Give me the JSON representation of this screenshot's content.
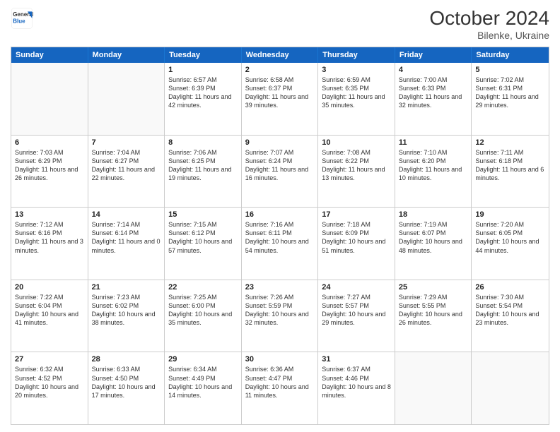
{
  "header": {
    "logo_line1": "General",
    "logo_line2": "Blue",
    "month": "October 2024",
    "location": "Bilenke, Ukraine"
  },
  "days_of_week": [
    "Sunday",
    "Monday",
    "Tuesday",
    "Wednesday",
    "Thursday",
    "Friday",
    "Saturday"
  ],
  "weeks": [
    [
      {
        "day": "",
        "info": "",
        "empty": true
      },
      {
        "day": "",
        "info": "",
        "empty": true
      },
      {
        "day": "1",
        "info": "Sunrise: 6:57 AM\nSunset: 6:39 PM\nDaylight: 11 hours and 42 minutes.",
        "empty": false
      },
      {
        "day": "2",
        "info": "Sunrise: 6:58 AM\nSunset: 6:37 PM\nDaylight: 11 hours and 39 minutes.",
        "empty": false
      },
      {
        "day": "3",
        "info": "Sunrise: 6:59 AM\nSunset: 6:35 PM\nDaylight: 11 hours and 35 minutes.",
        "empty": false
      },
      {
        "day": "4",
        "info": "Sunrise: 7:00 AM\nSunset: 6:33 PM\nDaylight: 11 hours and 32 minutes.",
        "empty": false
      },
      {
        "day": "5",
        "info": "Sunrise: 7:02 AM\nSunset: 6:31 PM\nDaylight: 11 hours and 29 minutes.",
        "empty": false
      }
    ],
    [
      {
        "day": "6",
        "info": "Sunrise: 7:03 AM\nSunset: 6:29 PM\nDaylight: 11 hours and 26 minutes.",
        "empty": false
      },
      {
        "day": "7",
        "info": "Sunrise: 7:04 AM\nSunset: 6:27 PM\nDaylight: 11 hours and 22 minutes.",
        "empty": false
      },
      {
        "day": "8",
        "info": "Sunrise: 7:06 AM\nSunset: 6:25 PM\nDaylight: 11 hours and 19 minutes.",
        "empty": false
      },
      {
        "day": "9",
        "info": "Sunrise: 7:07 AM\nSunset: 6:24 PM\nDaylight: 11 hours and 16 minutes.",
        "empty": false
      },
      {
        "day": "10",
        "info": "Sunrise: 7:08 AM\nSunset: 6:22 PM\nDaylight: 11 hours and 13 minutes.",
        "empty": false
      },
      {
        "day": "11",
        "info": "Sunrise: 7:10 AM\nSunset: 6:20 PM\nDaylight: 11 hours and 10 minutes.",
        "empty": false
      },
      {
        "day": "12",
        "info": "Sunrise: 7:11 AM\nSunset: 6:18 PM\nDaylight: 11 hours and 6 minutes.",
        "empty": false
      }
    ],
    [
      {
        "day": "13",
        "info": "Sunrise: 7:12 AM\nSunset: 6:16 PM\nDaylight: 11 hours and 3 minutes.",
        "empty": false
      },
      {
        "day": "14",
        "info": "Sunrise: 7:14 AM\nSunset: 6:14 PM\nDaylight: 11 hours and 0 minutes.",
        "empty": false
      },
      {
        "day": "15",
        "info": "Sunrise: 7:15 AM\nSunset: 6:12 PM\nDaylight: 10 hours and 57 minutes.",
        "empty": false
      },
      {
        "day": "16",
        "info": "Sunrise: 7:16 AM\nSunset: 6:11 PM\nDaylight: 10 hours and 54 minutes.",
        "empty": false
      },
      {
        "day": "17",
        "info": "Sunrise: 7:18 AM\nSunset: 6:09 PM\nDaylight: 10 hours and 51 minutes.",
        "empty": false
      },
      {
        "day": "18",
        "info": "Sunrise: 7:19 AM\nSunset: 6:07 PM\nDaylight: 10 hours and 48 minutes.",
        "empty": false
      },
      {
        "day": "19",
        "info": "Sunrise: 7:20 AM\nSunset: 6:05 PM\nDaylight: 10 hours and 44 minutes.",
        "empty": false
      }
    ],
    [
      {
        "day": "20",
        "info": "Sunrise: 7:22 AM\nSunset: 6:04 PM\nDaylight: 10 hours and 41 minutes.",
        "empty": false
      },
      {
        "day": "21",
        "info": "Sunrise: 7:23 AM\nSunset: 6:02 PM\nDaylight: 10 hours and 38 minutes.",
        "empty": false
      },
      {
        "day": "22",
        "info": "Sunrise: 7:25 AM\nSunset: 6:00 PM\nDaylight: 10 hours and 35 minutes.",
        "empty": false
      },
      {
        "day": "23",
        "info": "Sunrise: 7:26 AM\nSunset: 5:59 PM\nDaylight: 10 hours and 32 minutes.",
        "empty": false
      },
      {
        "day": "24",
        "info": "Sunrise: 7:27 AM\nSunset: 5:57 PM\nDaylight: 10 hours and 29 minutes.",
        "empty": false
      },
      {
        "day": "25",
        "info": "Sunrise: 7:29 AM\nSunset: 5:55 PM\nDaylight: 10 hours and 26 minutes.",
        "empty": false
      },
      {
        "day": "26",
        "info": "Sunrise: 7:30 AM\nSunset: 5:54 PM\nDaylight: 10 hours and 23 minutes.",
        "empty": false
      }
    ],
    [
      {
        "day": "27",
        "info": "Sunrise: 6:32 AM\nSunset: 4:52 PM\nDaylight: 10 hours and 20 minutes.",
        "empty": false
      },
      {
        "day": "28",
        "info": "Sunrise: 6:33 AM\nSunset: 4:50 PM\nDaylight: 10 hours and 17 minutes.",
        "empty": false
      },
      {
        "day": "29",
        "info": "Sunrise: 6:34 AM\nSunset: 4:49 PM\nDaylight: 10 hours and 14 minutes.",
        "empty": false
      },
      {
        "day": "30",
        "info": "Sunrise: 6:36 AM\nSunset: 4:47 PM\nDaylight: 10 hours and 11 minutes.",
        "empty": false
      },
      {
        "day": "31",
        "info": "Sunrise: 6:37 AM\nSunset: 4:46 PM\nDaylight: 10 hours and 8 minutes.",
        "empty": false
      },
      {
        "day": "",
        "info": "",
        "empty": true
      },
      {
        "day": "",
        "info": "",
        "empty": true
      }
    ]
  ]
}
